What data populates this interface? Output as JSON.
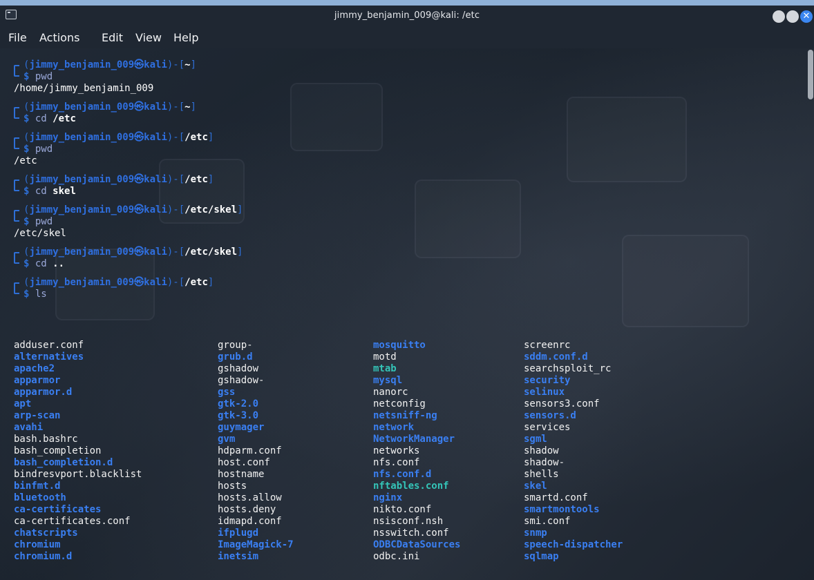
{
  "window": {
    "title": "jimmy_benjamin_009@kali: /etc"
  },
  "menu": [
    "File",
    "Actions",
    "Edit",
    "View",
    "Help"
  ],
  "colors": {
    "prompt": "#2f6fe0",
    "directory": "#3a7ff2",
    "symlink": "#34c4b8",
    "file": "#f2f2f2"
  },
  "prompt": {
    "open": "(",
    "user": "jimmy_benjamin_009",
    "symbol": "㉿",
    "host": "kali",
    "mid": ")-[",
    "close": "]",
    "dollar": "$"
  },
  "blocks": [
    {
      "path": "~",
      "cmd": "pwd",
      "arg": "",
      "output": "/home/jimmy_benjamin_009"
    },
    {
      "path": "~",
      "cmd": "cd",
      "arg": "/etc",
      "output": ""
    },
    {
      "path": "/etc",
      "cmd": "pwd",
      "arg": "",
      "output": "/etc"
    },
    {
      "path": "/etc",
      "cmd": "cd",
      "arg": "skel",
      "output": ""
    },
    {
      "path": "/etc/skel",
      "cmd": "pwd",
      "arg": "",
      "output": "/etc/skel"
    },
    {
      "path": "/etc/skel",
      "cmd": "cd",
      "arg": "..",
      "output": ""
    },
    {
      "path": "/etc",
      "cmd": "ls",
      "arg": "",
      "output": ""
    }
  ],
  "ls": {
    "columns": [
      [
        {
          "name": "adduser.conf",
          "type": "file"
        },
        {
          "name": "alternatives",
          "type": "dir"
        },
        {
          "name": "apache2",
          "type": "dir"
        },
        {
          "name": "apparmor",
          "type": "dir"
        },
        {
          "name": "apparmor.d",
          "type": "dir"
        },
        {
          "name": "apt",
          "type": "dir"
        },
        {
          "name": "arp-scan",
          "type": "dir"
        },
        {
          "name": "avahi",
          "type": "dir"
        },
        {
          "name": "bash.bashrc",
          "type": "file"
        },
        {
          "name": "bash_completion",
          "type": "file"
        },
        {
          "name": "bash_completion.d",
          "type": "dir"
        },
        {
          "name": "bindresvport.blacklist",
          "type": "file"
        },
        {
          "name": "binfmt.d",
          "type": "dir"
        },
        {
          "name": "bluetooth",
          "type": "dir"
        },
        {
          "name": "ca-certificates",
          "type": "dir"
        },
        {
          "name": "ca-certificates.conf",
          "type": "file"
        },
        {
          "name": "chatscripts",
          "type": "dir"
        },
        {
          "name": "chromium",
          "type": "dir"
        },
        {
          "name": "chromium.d",
          "type": "dir"
        }
      ],
      [
        {
          "name": "group-",
          "type": "file"
        },
        {
          "name": "grub.d",
          "type": "dir"
        },
        {
          "name": "gshadow",
          "type": "file"
        },
        {
          "name": "gshadow-",
          "type": "file"
        },
        {
          "name": "gss",
          "type": "dir"
        },
        {
          "name": "gtk-2.0",
          "type": "dir"
        },
        {
          "name": "gtk-3.0",
          "type": "dir"
        },
        {
          "name": "guymager",
          "type": "dir"
        },
        {
          "name": "gvm",
          "type": "dir"
        },
        {
          "name": "hdparm.conf",
          "type": "file"
        },
        {
          "name": "host.conf",
          "type": "file"
        },
        {
          "name": "hostname",
          "type": "file"
        },
        {
          "name": "hosts",
          "type": "file"
        },
        {
          "name": "hosts.allow",
          "type": "file"
        },
        {
          "name": "hosts.deny",
          "type": "file"
        },
        {
          "name": "idmapd.conf",
          "type": "file"
        },
        {
          "name": "ifplugd",
          "type": "dir"
        },
        {
          "name": "ImageMagick-7",
          "type": "dir"
        },
        {
          "name": "inetsim",
          "type": "dir"
        }
      ],
      [
        {
          "name": "mosquitto",
          "type": "dir"
        },
        {
          "name": "motd",
          "type": "file"
        },
        {
          "name": "mtab",
          "type": "link"
        },
        {
          "name": "mysql",
          "type": "dir"
        },
        {
          "name": "nanorc",
          "type": "file"
        },
        {
          "name": "netconfig",
          "type": "file"
        },
        {
          "name": "netsniff-ng",
          "type": "dir"
        },
        {
          "name": "network",
          "type": "dir"
        },
        {
          "name": "NetworkManager",
          "type": "dir"
        },
        {
          "name": "networks",
          "type": "file"
        },
        {
          "name": "nfs.conf",
          "type": "file"
        },
        {
          "name": "nfs.conf.d",
          "type": "dir"
        },
        {
          "name": "nftables.conf",
          "type": "link"
        },
        {
          "name": "nginx",
          "type": "dir"
        },
        {
          "name": "nikto.conf",
          "type": "file"
        },
        {
          "name": "nsisconf.nsh",
          "type": "file"
        },
        {
          "name": "nsswitch.conf",
          "type": "file"
        },
        {
          "name": "ODBCDataSources",
          "type": "dir"
        },
        {
          "name": "odbc.ini",
          "type": "file"
        }
      ],
      [
        {
          "name": "screenrc",
          "type": "file"
        },
        {
          "name": "sddm.conf.d",
          "type": "dir"
        },
        {
          "name": "searchsploit_rc",
          "type": "file"
        },
        {
          "name": "security",
          "type": "dir"
        },
        {
          "name": "selinux",
          "type": "dir"
        },
        {
          "name": "sensors3.conf",
          "type": "file"
        },
        {
          "name": "sensors.d",
          "type": "dir"
        },
        {
          "name": "services",
          "type": "file"
        },
        {
          "name": "sgml",
          "type": "dir"
        },
        {
          "name": "shadow",
          "type": "file"
        },
        {
          "name": "shadow-",
          "type": "file"
        },
        {
          "name": "shells",
          "type": "file"
        },
        {
          "name": "skel",
          "type": "dir"
        },
        {
          "name": "smartd.conf",
          "type": "file"
        },
        {
          "name": "smartmontools",
          "type": "dir"
        },
        {
          "name": "smi.conf",
          "type": "file"
        },
        {
          "name": "snmp",
          "type": "dir"
        },
        {
          "name": "speech-dispatcher",
          "type": "dir"
        },
        {
          "name": "sqlmap",
          "type": "dir"
        }
      ]
    ]
  }
}
